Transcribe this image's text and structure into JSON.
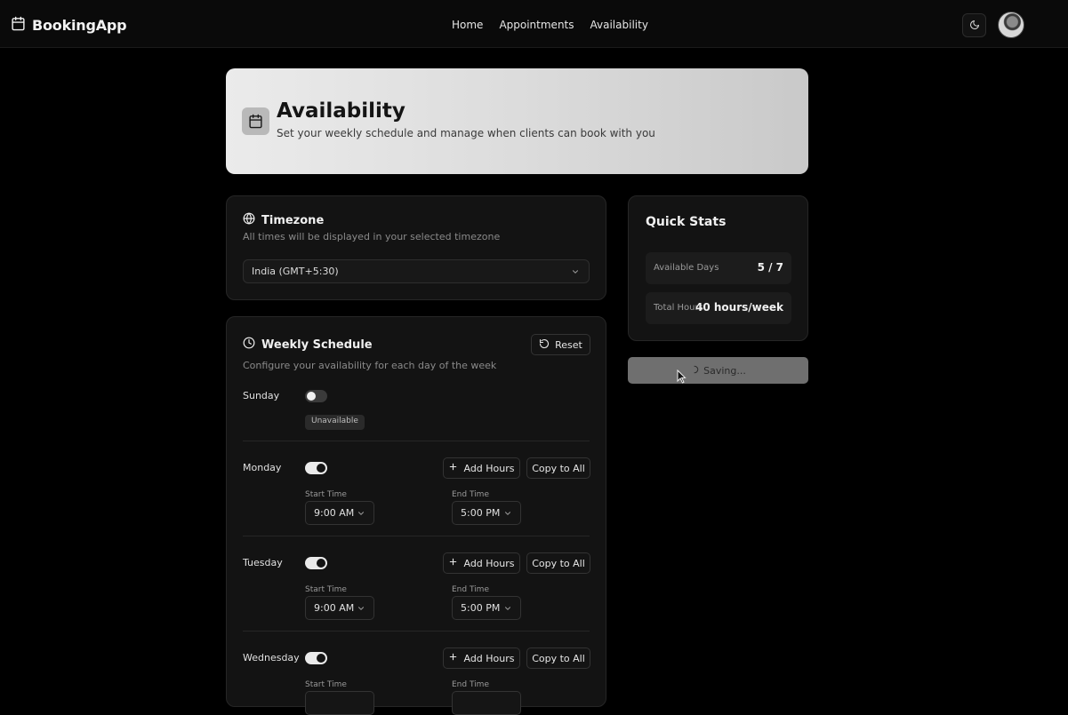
{
  "app": {
    "name": "BookingApp"
  },
  "nav": {
    "links": [
      "Home",
      "Appointments",
      "Availability"
    ]
  },
  "hero": {
    "title": "Availability",
    "subtitle": "Set your weekly schedule and manage when clients can book with you"
  },
  "timezone": {
    "title": "Timezone",
    "description": "All times will be displayed in your selected timezone",
    "selected": "India (GMT+5:30)"
  },
  "schedule": {
    "title": "Weekly Schedule",
    "description": "Configure your availability for each day of the week",
    "reset_label": "Reset",
    "add_hours_label": "Add Hours",
    "copy_label": "Copy to All",
    "start_label": "Start Time",
    "end_label": "End Time",
    "unavailable_label": "Unavailable",
    "days": [
      {
        "name": "Sunday",
        "enabled": false
      },
      {
        "name": "Monday",
        "enabled": true,
        "start": "9:00 AM",
        "end": "5:00 PM"
      },
      {
        "name": "Tuesday",
        "enabled": true,
        "start": "9:00 AM",
        "end": "5:00 PM"
      },
      {
        "name": "Wednesday",
        "enabled": true
      }
    ]
  },
  "stats": {
    "title": "Quick Stats",
    "available_days_label": "Available Days",
    "available_days_value": "5 / 7",
    "total_hours_label": "Total Hours",
    "total_hours_value": "40 hours/week"
  },
  "save": {
    "label": "Saving..."
  }
}
